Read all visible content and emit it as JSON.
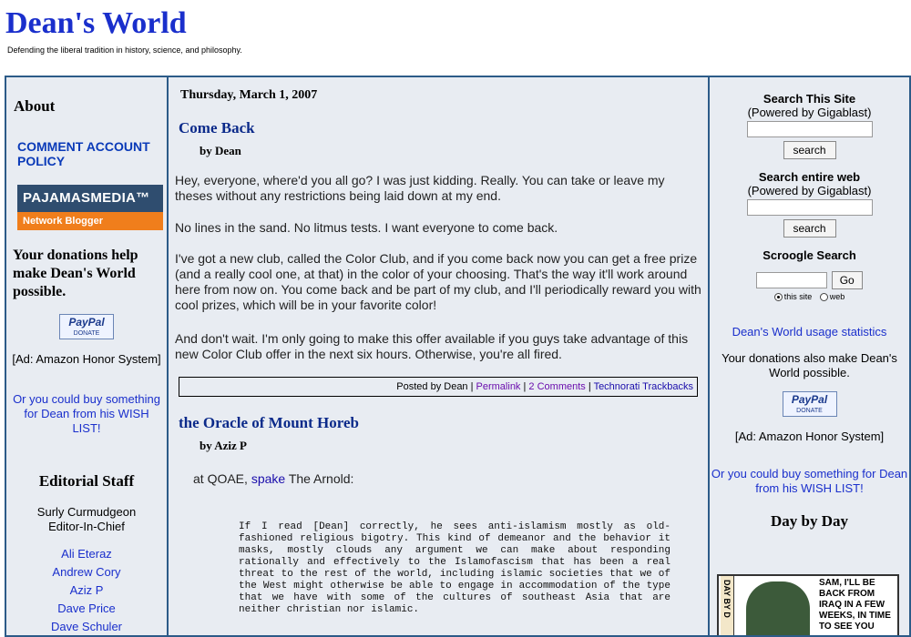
{
  "site": {
    "title": "Dean's World",
    "tagline": "Defending the liberal tradition in history, science, and philosophy."
  },
  "left": {
    "about": "About",
    "policy": "COMMENT ACCOUNT POLICY",
    "pajamas_top": "PAJAMASMEDIA™",
    "pajamas_bottom": "Network Blogger",
    "donate_heading": "Your donations help make Dean's World possible.",
    "paypal_top": "PayPal",
    "paypal_bottom": "DONATE",
    "amazon": "[Ad: Amazon Honor System]",
    "wish": "Or you could buy something for Dean from his WISH LIST!",
    "editorial": "Editorial Staff",
    "editor_in_chief_name": "Surly Curmudgeon",
    "editor_in_chief_role": "Editor-In-Chief",
    "staff": [
      "Ali Eteraz",
      "Andrew Cory",
      "Aziz P",
      "Dave Price",
      "Dave Schuler"
    ]
  },
  "center": {
    "date": "Thursday, March 1, 2007",
    "post1": {
      "title": "Come Back",
      "byline": "by Dean",
      "p1": "Hey, everyone, where'd you all go? I was just kidding. Really. You can take or leave my theses without any restrictions being laid down at my end.",
      "p2": "No lines in the sand. No litmus tests. I want everyone to come back.",
      "p3": "I've got a new club, called the Color Club, and if you come back now you can get a free prize (and a really cool one, at that) in the color of your choosing. That's the way it'll work around here from now on. You come back and be part of my club, and I'll periodically reward you with cool prizes, which will be in your favorite color!",
      "p4": "And don't wait. I'm only going to make this offer available if you guys take advantage of this new Color Club offer in the next six hours. Otherwise, you're all fired.",
      "posted_by": "Posted by Dean |",
      "permalink": "Permalink",
      "sep1": "|",
      "comments": "2 Comments",
      "sep2": "|",
      "trackbacks": "Technorati Trackbacks"
    },
    "post2": {
      "title": "the Oracle of Mount Horeb",
      "byline": "by Aziz P",
      "intro_pre": "at QOAE,",
      "intro_link": "spake",
      "intro_post": "The Arnold:",
      "quote": "If I read [Dean] correctly, he sees anti-islamism mostly as old-fashioned religious bigotry. This kind of demeanor and the behavior it masks, mostly clouds any argument we can make about responding rationally and effectively to the Islamofascism that has been a real threat to the rest of the world, including islamic societies that we of the West might otherwise be able to engage in accommodation of the type that we have with some of the cultures of southeast Asia that are neither christian nor islamic."
    }
  },
  "right": {
    "search_site_head": "Search This Site",
    "search_site_sub": "(Powered by Gigablast)",
    "search_btn": "search",
    "search_web_head": "Search entire web",
    "search_web_sub": "(Powered by Gigablast)",
    "search_btn2": "search",
    "scroogle_head": "Scroogle Search",
    "go_btn": "Go",
    "radio_site": "this site",
    "radio_web": "web",
    "usage": "Dean's World usage statistics",
    "donations": "Your donations also make Dean's World possible.",
    "paypal_top": "PayPal",
    "paypal_bottom": "DONATE",
    "amazon": "[Ad: Amazon Honor System]",
    "wish": "Or you could buy something for Dean from his WISH LIST!",
    "day_by_day": "Day by Day",
    "comic_side": "DAY BY D",
    "comic_bubble": "SAM, I'LL BE BACK FROM IRAQ IN A FEW WEEKS, IN TIME TO SEE YOU"
  }
}
